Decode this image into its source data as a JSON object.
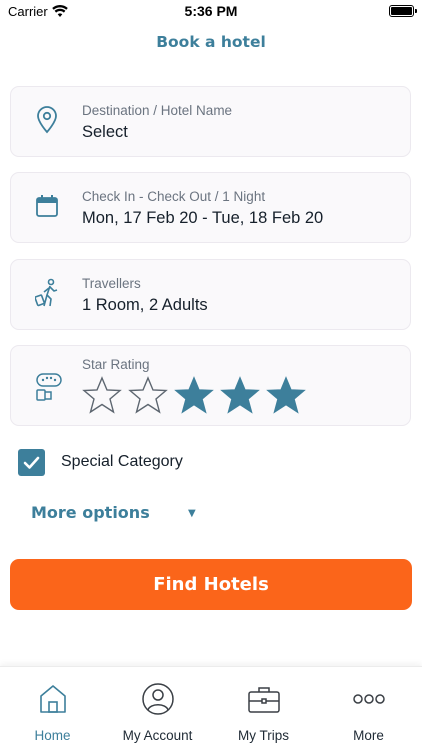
{
  "status_bar": {
    "carrier": "Carrier",
    "time": "5:36 PM"
  },
  "header": {
    "title": "Book a hotel"
  },
  "destination": {
    "label": "Destination / Hotel Name",
    "value": "Select",
    "icon": "location-pin-icon"
  },
  "dates": {
    "label": "Check In - Check Out / 1 Night",
    "value": "Mon, 17 Feb 20 - Tue, 18 Feb 20",
    "icon": "calendar-icon"
  },
  "travellers": {
    "label": "Travellers",
    "value": "1 Room, 2 Adults",
    "icon": "traveller-icon"
  },
  "star_rating": {
    "label": "Star Rating",
    "icon": "hotel-rating-icon",
    "selected": [
      false,
      false,
      true,
      true,
      true
    ]
  },
  "special_category": {
    "label": "Special Category",
    "checked": true
  },
  "more_options": {
    "label": "More options"
  },
  "find_button": {
    "label": "Find Hotels"
  },
  "tabs": [
    {
      "label": "Home",
      "icon": "home-icon",
      "active": true
    },
    {
      "label": "My Account",
      "icon": "account-icon",
      "active": false
    },
    {
      "label": "My Trips",
      "icon": "briefcase-icon",
      "active": false
    },
    {
      "label": "More",
      "icon": "more-dots-icon",
      "active": false
    }
  ],
  "colors": {
    "accent": "#3d7f9b",
    "cta": "#fb651a",
    "card_bg": "#faf9fb"
  }
}
